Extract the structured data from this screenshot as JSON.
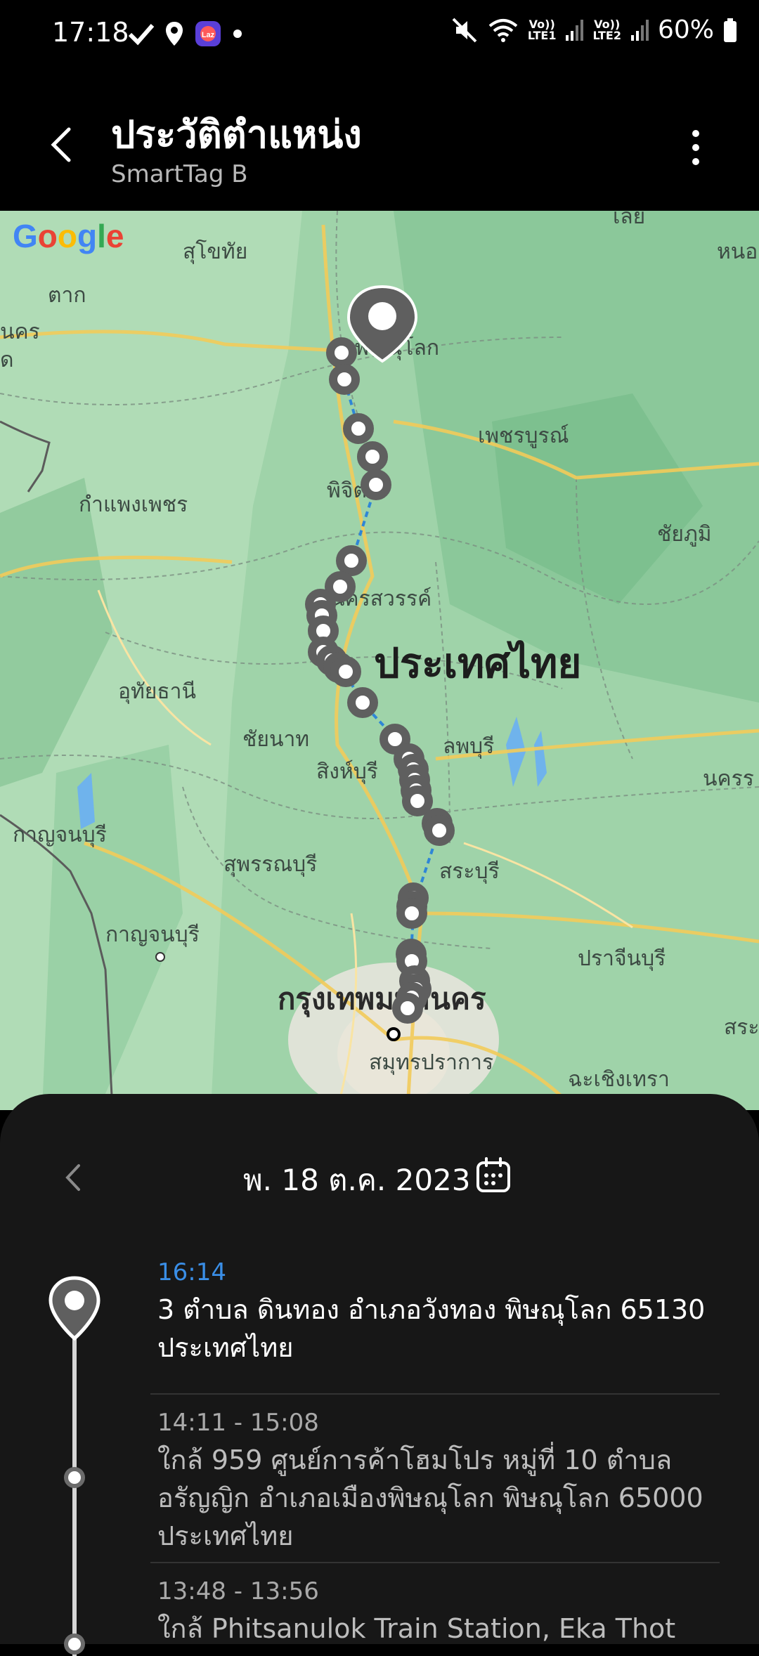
{
  "status_bar": {
    "time": "17:18",
    "lte1": "Vo))\nLTE1",
    "lte2": "Vo))\nLTE2",
    "battery": "60%"
  },
  "app_bar": {
    "title": "ประวัติตำแหน่ง",
    "subtitle": "SmartTag B"
  },
  "map": {
    "provider_logo": "Google",
    "labels": {
      "loei": "เลย",
      "sukhothai": "สุโขทัย",
      "nong": "หนอ",
      "tak": "ตาก",
      "phitsanulok": "พิษณุโลก",
      "nakhon_left": "นคร",
      "do_left": "ด",
      "phetchabun": "เพชรบูรณ์",
      "kamphaeng": "กำแพงเพชร",
      "phichit": "พิจิตร",
      "chaiyaphum": "ชัยภูมิ",
      "nakhonsawan": "นครสวรรค์",
      "country": "ประเทศไทย",
      "uthai": "อุทัยธานี",
      "chainat": "ชัยนาท",
      "lopburi": "ลพบุรี",
      "singburi": "สิงห์บุรี",
      "nakhon_right": "นครร",
      "kanchanaburi_prov": "กาญจนบุรี",
      "suphanburi": "สุพรรณบุรี",
      "saraburi": "สระบุรี",
      "kanchanaburi_city": "กาญจนบุรี",
      "prachinburi": "ปราจีนบุรี",
      "bangkok": "กรุงเทพมหานคร",
      "sra": "สระ",
      "samutprakan": "สมุทรปราการ",
      "chachoengsao": "ฉะเชิงเทรา"
    },
    "accent_route_color": "#2f86d6",
    "marker_color": "#5f5f5f"
  },
  "history": {
    "date": "พ. 18 ต.ค. 2023",
    "entries": [
      {
        "time": "16:14",
        "address": "3 ตำบล ดินทอง อำเภอวังทอง พิษณุโลก 65130 ประเทศไทย",
        "time_color": "#3a8ee6"
      },
      {
        "time": "14:11 - 15:08",
        "address": "ใกล้ 959 ศูนย์การค้าโฮมโปร หมู่ที่ 10 ตำบล อรัญญิก อำเภอเมืองพิษณุโลก พิษณุโลก 65000 ประเทศไทย"
      },
      {
        "time": "13:48 - 13:56",
        "address": "ใกล้ Phitsanulok Train Station, Eka Thot"
      }
    ]
  }
}
